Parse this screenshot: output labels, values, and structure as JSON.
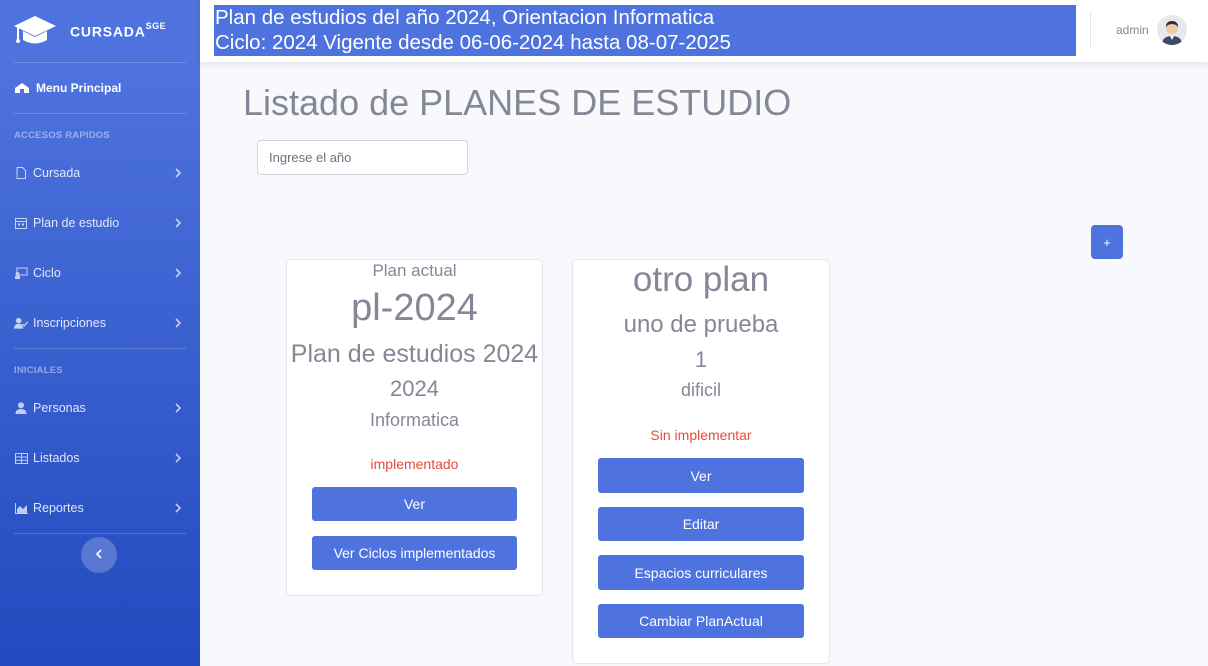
{
  "brand": {
    "name": "CURSADA",
    "sup": "SGE"
  },
  "sidebar": {
    "menu_principal": "Menu Principal",
    "heading_accesos": "ACCESOS RAPIDOS",
    "heading_iniciales": "INICIALES",
    "items": [
      {
        "label": "Cursada",
        "icon": "file-icon"
      },
      {
        "label": "Plan de estudio",
        "icon": "calendar-icon"
      },
      {
        "label": "Ciclo",
        "icon": "ciclo-icon"
      },
      {
        "label": "Inscripciones",
        "icon": "user-check-icon"
      },
      {
        "label": "Personas",
        "icon": "user-tie-icon"
      },
      {
        "label": "Listados",
        "icon": "table-icon"
      },
      {
        "label": "Reportes",
        "icon": "chart-area-icon"
      }
    ]
  },
  "topbar": {
    "plan_line1": "Plan de estudios del año 2024, Orientacion Informatica",
    "plan_line2": "Ciclo: 2024 Vigente desde 06-06-2024 hasta 08-07-2025",
    "username": "admin"
  },
  "main": {
    "title": "Listado de PLANES DE ESTUDIO",
    "search_placeholder": "Ingrese el año",
    "add_label": "+"
  },
  "cards": [
    {
      "badge": "Plan actual",
      "code": "pl-2024",
      "name": "Plan de estudios 2024",
      "year": "2024",
      "orientation": "Informatica",
      "status": "implementado",
      "buttons": [
        "Ver",
        "Ver Ciclos implementados"
      ]
    },
    {
      "code": "otro plan",
      "name": "uno de prueba",
      "year": "1",
      "orientation": "dificil",
      "status": "Sin implementar",
      "buttons": [
        "Ver",
        "Editar",
        "Espacios curriculares",
        "Cambiar PlanActual"
      ]
    }
  ],
  "colors": {
    "primary": "#4e73df",
    "danger": "#e74a3b",
    "text_muted": "#858796"
  }
}
